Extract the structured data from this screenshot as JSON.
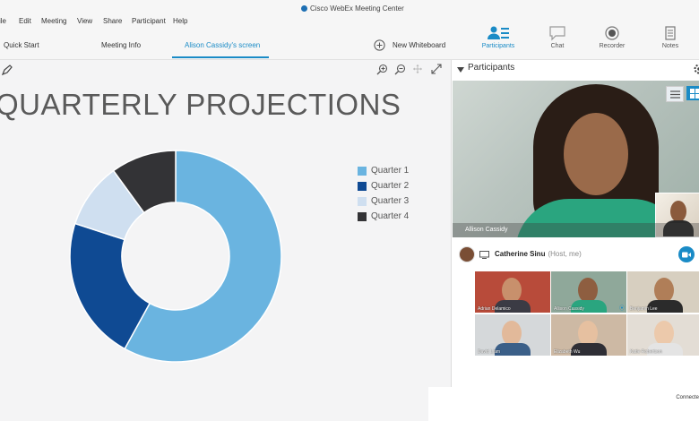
{
  "window": {
    "title": "Cisco WebEx Meeting Center"
  },
  "menu": [
    "ile",
    "Edit",
    "Meeting",
    "View",
    "Share",
    "Participant",
    "Help"
  ],
  "tabs": {
    "quick_start": "Quick Start",
    "meeting_info": "Meeting Info",
    "screen": "Alison Cassidy's screen",
    "new_whiteboard": "New Whiteboard"
  },
  "tools": {
    "participants": "Participants",
    "chat": "Chat",
    "recorder": "Recorder",
    "notes": "Notes"
  },
  "slide": {
    "title": "QUARTERLY PROJECTIONS"
  },
  "chart_data": {
    "type": "pie",
    "categories": [
      "Quarter 1",
      "Quarter 2",
      "Quarter 3",
      "Quarter 4"
    ],
    "values": [
      58,
      22,
      10,
      10
    ],
    "colors": [
      "#6ab4e0",
      "#0f4a93",
      "#cfdff0",
      "#333336"
    ],
    "legend": "right"
  },
  "participants_panel": {
    "title": "Participants",
    "main_video_name": "Allison Cassidy",
    "host_name": "Catherine Sinu",
    "host_role": "(Host, me)",
    "thumbnails": [
      "Adrian Delamico",
      "Allison Cassidy",
      "Benjamin Lee",
      "David Liam",
      "Elizabeth Wu",
      "Katie Robertson"
    ]
  },
  "status": {
    "text": "Connecte"
  }
}
